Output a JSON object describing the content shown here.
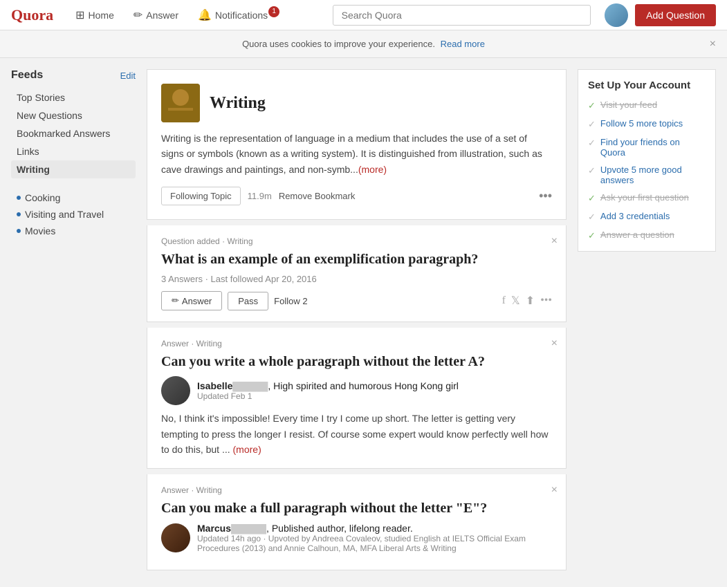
{
  "brand": {
    "name": "Quora"
  },
  "navbar": {
    "home_label": "Home",
    "answer_label": "Answer",
    "notifications_label": "Notifications",
    "notifications_count": "1",
    "search_placeholder": "Search Quora",
    "add_question_label": "Add Question"
  },
  "cookie_banner": {
    "message": "Quora uses cookies to improve your experience.",
    "read_more": "Read more"
  },
  "sidebar": {
    "title": "Feeds",
    "edit_label": "Edit",
    "nav_items": [
      {
        "label": "Top Stories",
        "active": false
      },
      {
        "label": "New Questions",
        "active": false
      },
      {
        "label": "Bookmarked Answers",
        "active": false
      },
      {
        "label": "Links",
        "active": false
      },
      {
        "label": "Writing",
        "active": true
      }
    ],
    "topics": [
      {
        "label": "Cooking"
      },
      {
        "label": "Visiting and Travel"
      },
      {
        "label": "Movies"
      }
    ]
  },
  "topic_card": {
    "title": "Writing",
    "description": "Writing is the representation of language in a medium that includes the use of a set of signs or symbols (known as a writing system). It is distinguished from illustration, such as cave drawings and paintings, and non-symb...",
    "more_label": "(more)",
    "following_btn": "Following Topic",
    "follower_count": "11.9m",
    "remove_bookmark_btn": "Remove Bookmark",
    "more_dots": "•••"
  },
  "question_card": {
    "meta": "Question added · Writing",
    "title": "What is an example of an exemplification paragraph?",
    "stats": "3 Answers · Last followed Apr 20, 2016",
    "answer_btn": "Answer",
    "pass_btn": "Pass",
    "follow_label": "Follow",
    "follow_count": "2"
  },
  "answer_card_1": {
    "meta": "Answer · Writing",
    "title": "Can you write a whole paragraph without the letter A?",
    "author_name": "Isabelle",
    "author_redacted": "██████",
    "author_desc": ", High spirited and humorous Hong Kong girl",
    "date": "Updated Feb 1",
    "text": "No, I think it's impossible! Every time I try I come up short. The letter is getting very tempting to press the longer I resist. Of course some expert would know perfectly well how to do this, but ...",
    "more_label": "(more)"
  },
  "answer_card_2": {
    "meta": "Answer · Writing",
    "title": "Can you make a full paragraph without the letter \"E\"?",
    "author_name": "Marcus",
    "author_redacted": "██████",
    "author_desc": ", Published author, lifelong reader.",
    "date_label": "Updated 14h ago",
    "upvote_text": "· Upvoted by Andreea Covaleov, studied English at IELTS Official Exam Procedures (2013) and Annie Calhoun, MA, MFA Liberal Arts & Writing"
  },
  "setup_card": {
    "title": "Set Up Your Account",
    "items": [
      {
        "label": "Visit your feed",
        "done": true,
        "strikethrough": true
      },
      {
        "label": "Follow 5 more topics",
        "done": false,
        "strikethrough": false
      },
      {
        "label": "Find your friends on Quora",
        "done": false,
        "strikethrough": false
      },
      {
        "label": "Upvote 5 more good answers",
        "done": false,
        "strikethrough": false
      },
      {
        "label": "Ask your first question",
        "done": true,
        "strikethrough": true
      },
      {
        "label": "Add 3 credentials",
        "done": false,
        "strikethrough": false
      },
      {
        "label": "Answer a question",
        "done": true,
        "strikethrough": true
      }
    ]
  }
}
